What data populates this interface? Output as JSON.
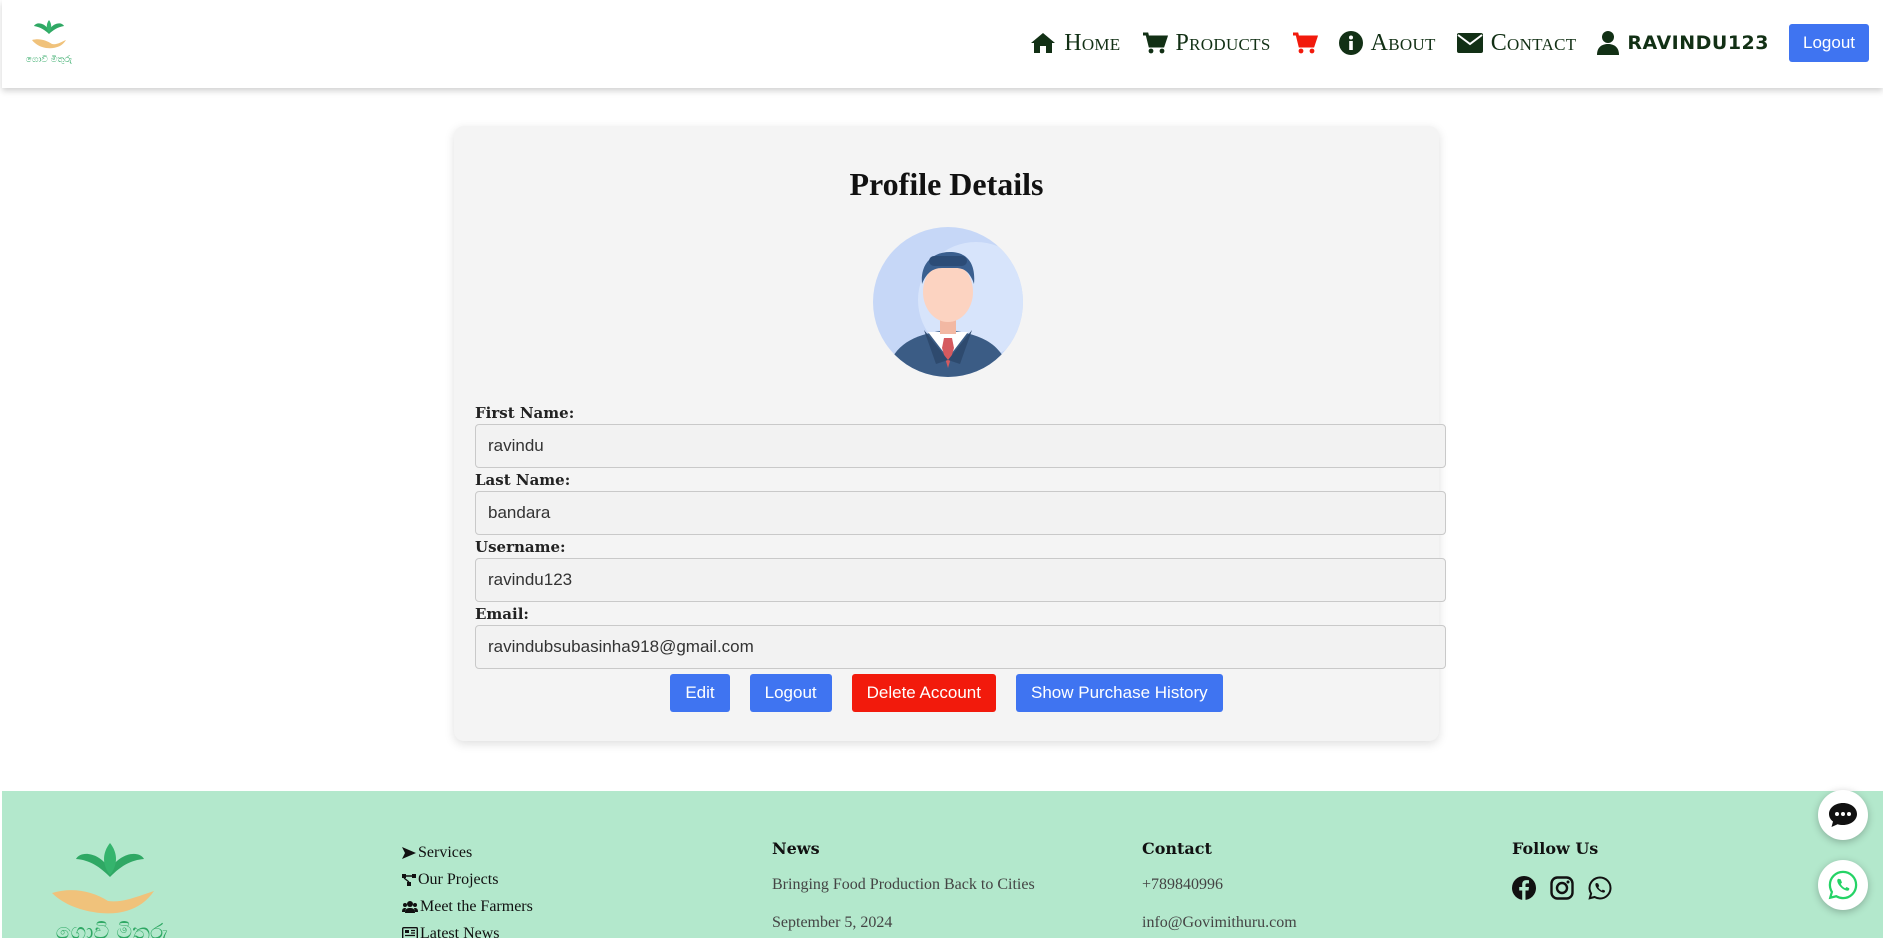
{
  "nav": {
    "items": [
      {
        "label": "Home",
        "icon": "home-icon"
      },
      {
        "label": "Products",
        "icon": "shopping-cart-icon"
      },
      {
        "label": "About",
        "icon": "info-circle-icon"
      },
      {
        "label": "Contact",
        "icon": "envelope-icon"
      }
    ],
    "cart_icon": "cart-icon",
    "user_label": "RAVINDU123",
    "logout_label": "Logout"
  },
  "profile": {
    "title": "Profile Details",
    "fields": [
      {
        "label": "First Name:",
        "value": "ravindu"
      },
      {
        "label": "Last Name:",
        "value": "bandara"
      },
      {
        "label": "Username:",
        "value": "ravindu123"
      },
      {
        "label": "Email:",
        "value": "ravindubsubasinha918@gmail.com"
      }
    ],
    "buttons": {
      "edit": "Edit",
      "logout": "Logout",
      "delete": "Delete Account",
      "history": "Show Purchase History"
    }
  },
  "footer": {
    "links": [
      "Services",
      "Our Projects",
      "Meet the Farmers",
      "Latest News"
    ],
    "news": {
      "heading": "News",
      "items": [
        "Bringing Food Production Back to Cities",
        "September 5, 2024"
      ]
    },
    "contact": {
      "heading": "Contact",
      "items": [
        "+789840996",
        "info@Govimithuru.com"
      ]
    },
    "follow": {
      "heading": "Follow Us",
      "icons": [
        "facebook-icon",
        "instagram-icon",
        "whatsapp-icon"
      ]
    }
  },
  "colors": {
    "primary": "#3f74f1",
    "danger": "#f21a0c",
    "nav_text": "#123015",
    "footer_bg": "#b3e8cc",
    "brand_green": "#2fa864",
    "hand": "#f0c27b"
  }
}
